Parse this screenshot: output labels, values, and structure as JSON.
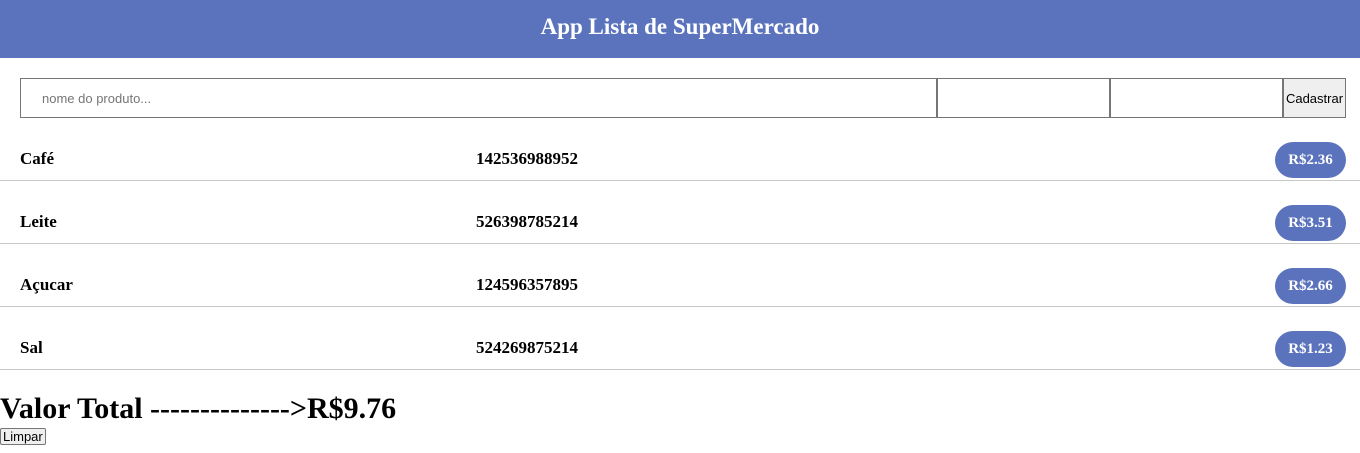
{
  "header": {
    "title": "App Lista de SuperMercado"
  },
  "form": {
    "name_placeholder": "nome do produto...",
    "name_value": "",
    "code_value": "",
    "price_value": "",
    "submit_label": "Cadastrar"
  },
  "items": [
    {
      "name": "Café",
      "code": "142536988952",
      "price": "R$2.36"
    },
    {
      "name": "Leite",
      "code": "526398785214",
      "price": "R$3.51"
    },
    {
      "name": "Açucar",
      "code": "124596357895",
      "price": "R$2.66"
    },
    {
      "name": "Sal",
      "code": "524269875214",
      "price": "R$1.23"
    }
  ],
  "total": {
    "label": "Valor Total -------------->R$9.76"
  },
  "clear_label": "Limpar",
  "colors": {
    "accent": "#5b73bc",
    "divider": "#c8c8c8"
  }
}
